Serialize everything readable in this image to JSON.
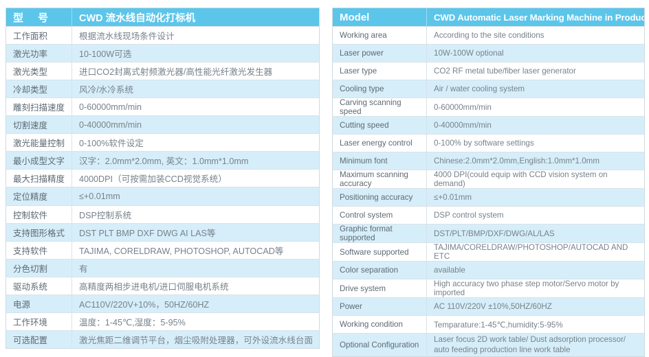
{
  "colors": {
    "header_blue": "#5cc5ea",
    "band_blue": "#d6eef9",
    "border": "#d8e2e8",
    "text": "#6f7b84",
    "header_text": "#ffffff"
  },
  "left_table": {
    "header": {
      "label": "型　号",
      "value": "CWD 流水线自动化打标机"
    },
    "rows": [
      {
        "label": "工作面积",
        "value": "根据流水线现场条件设计"
      },
      {
        "label": "激光功率",
        "value": "10-100W可选"
      },
      {
        "label": "激光类型",
        "value": "进口CO2封离式射频激光器/高性能光纤激光发生器"
      },
      {
        "label": "冷却类型",
        "value": "风冷/水冷系统"
      },
      {
        "label": "雕刻扫描速度",
        "value": "0-60000mm/min"
      },
      {
        "label": "切割速度",
        "value": "0-40000mm/min"
      },
      {
        "label": "激光能量控制",
        "value": "0-100%软件设定"
      },
      {
        "label": "最小成型文字",
        "value": "汉字：2.0mm*2.0mm, 英文：1.0mm*1.0mm"
      },
      {
        "label": "最大扫描精度",
        "value": "4000DPI（可按需加装CCD视觉系统）"
      },
      {
        "label": "定位精度",
        "value": "≤+0.01mm"
      },
      {
        "label": "控制软件",
        "value": "DSP控制系统"
      },
      {
        "label": "支持图形格式",
        "value": "DST PLT BMP DXF DWG AI LAS等"
      },
      {
        "label": "支持软件",
        "value": "TAJIMA, CORELDRAW, PHOTOSHOP, AUTOCAD等"
      },
      {
        "label": "分色切割",
        "value": "有"
      },
      {
        "label": "驱动系统",
        "value": "高精度两相步进电机/进口伺服电机系统"
      },
      {
        "label": "电源",
        "value": "AC110V/220V+10%，50HZ/60HZ"
      },
      {
        "label": "工作环境",
        "value": "温度：1-45℃,湿度：5-95%"
      },
      {
        "label": "可选配置",
        "value": "激光焦距二维调节平台，烟尘吸附处理器，可外设流水线台面"
      }
    ]
  },
  "right_table": {
    "header": {
      "label": "Model",
      "value": "CWD Automatic Laser Marking Machine in Production Line"
    },
    "rows": [
      {
        "label": "Working area",
        "value": "According to the site conditions"
      },
      {
        "label": "Laser power",
        "value": "10W-100W optional"
      },
      {
        "label": "Laser type",
        "value": "CO2 RF metal tube/fiber laser generator"
      },
      {
        "label": "Cooling type",
        "value": "Air / water cooling system"
      },
      {
        "label": "Carving scanning speed",
        "value": "0-60000mm/min"
      },
      {
        "label": "Cutting speed",
        "value": "0-40000mm/min"
      },
      {
        "label": "Laser energy control",
        "value": "0-100% by software settings"
      },
      {
        "label": "Minimum font",
        "value": "Chinese:2.0mm*2.0mm,English:1.0mm*1.0mm"
      },
      {
        "label": "Maximum scanning accuracy",
        "value": "4000 DPI(could equip with CCD vision system on demand)"
      },
      {
        "label": "Positioning accuracy",
        "value": "≤+0.01mm"
      },
      {
        "label": "Control system",
        "value": "DSP control system"
      },
      {
        "label": "Graphic format supported",
        "value": "DST/PLT/BMP/DXF/DWG/AL/LAS"
      },
      {
        "label": "Software supported",
        "value": "TAJIMA/CORELDRAW/PHOTOSHOP/AUTOCAD AND ETC"
      },
      {
        "label": "Color separation",
        "value": "available"
      },
      {
        "label": "Drive system",
        "value": "High accuracy two phase step motor/Servo motor by imported"
      },
      {
        "label": "Power",
        "value": "AC 110V/220V ±10%,50HZ/60HZ"
      },
      {
        "label": "Working condition",
        "value": "Temparature:1-45℃,humidity:5-95%"
      },
      {
        "label": "Optional Configuration",
        "value": "Laser focus 2D work table/ Dust adsorption processor/ auto feeding production line work table"
      }
    ]
  }
}
